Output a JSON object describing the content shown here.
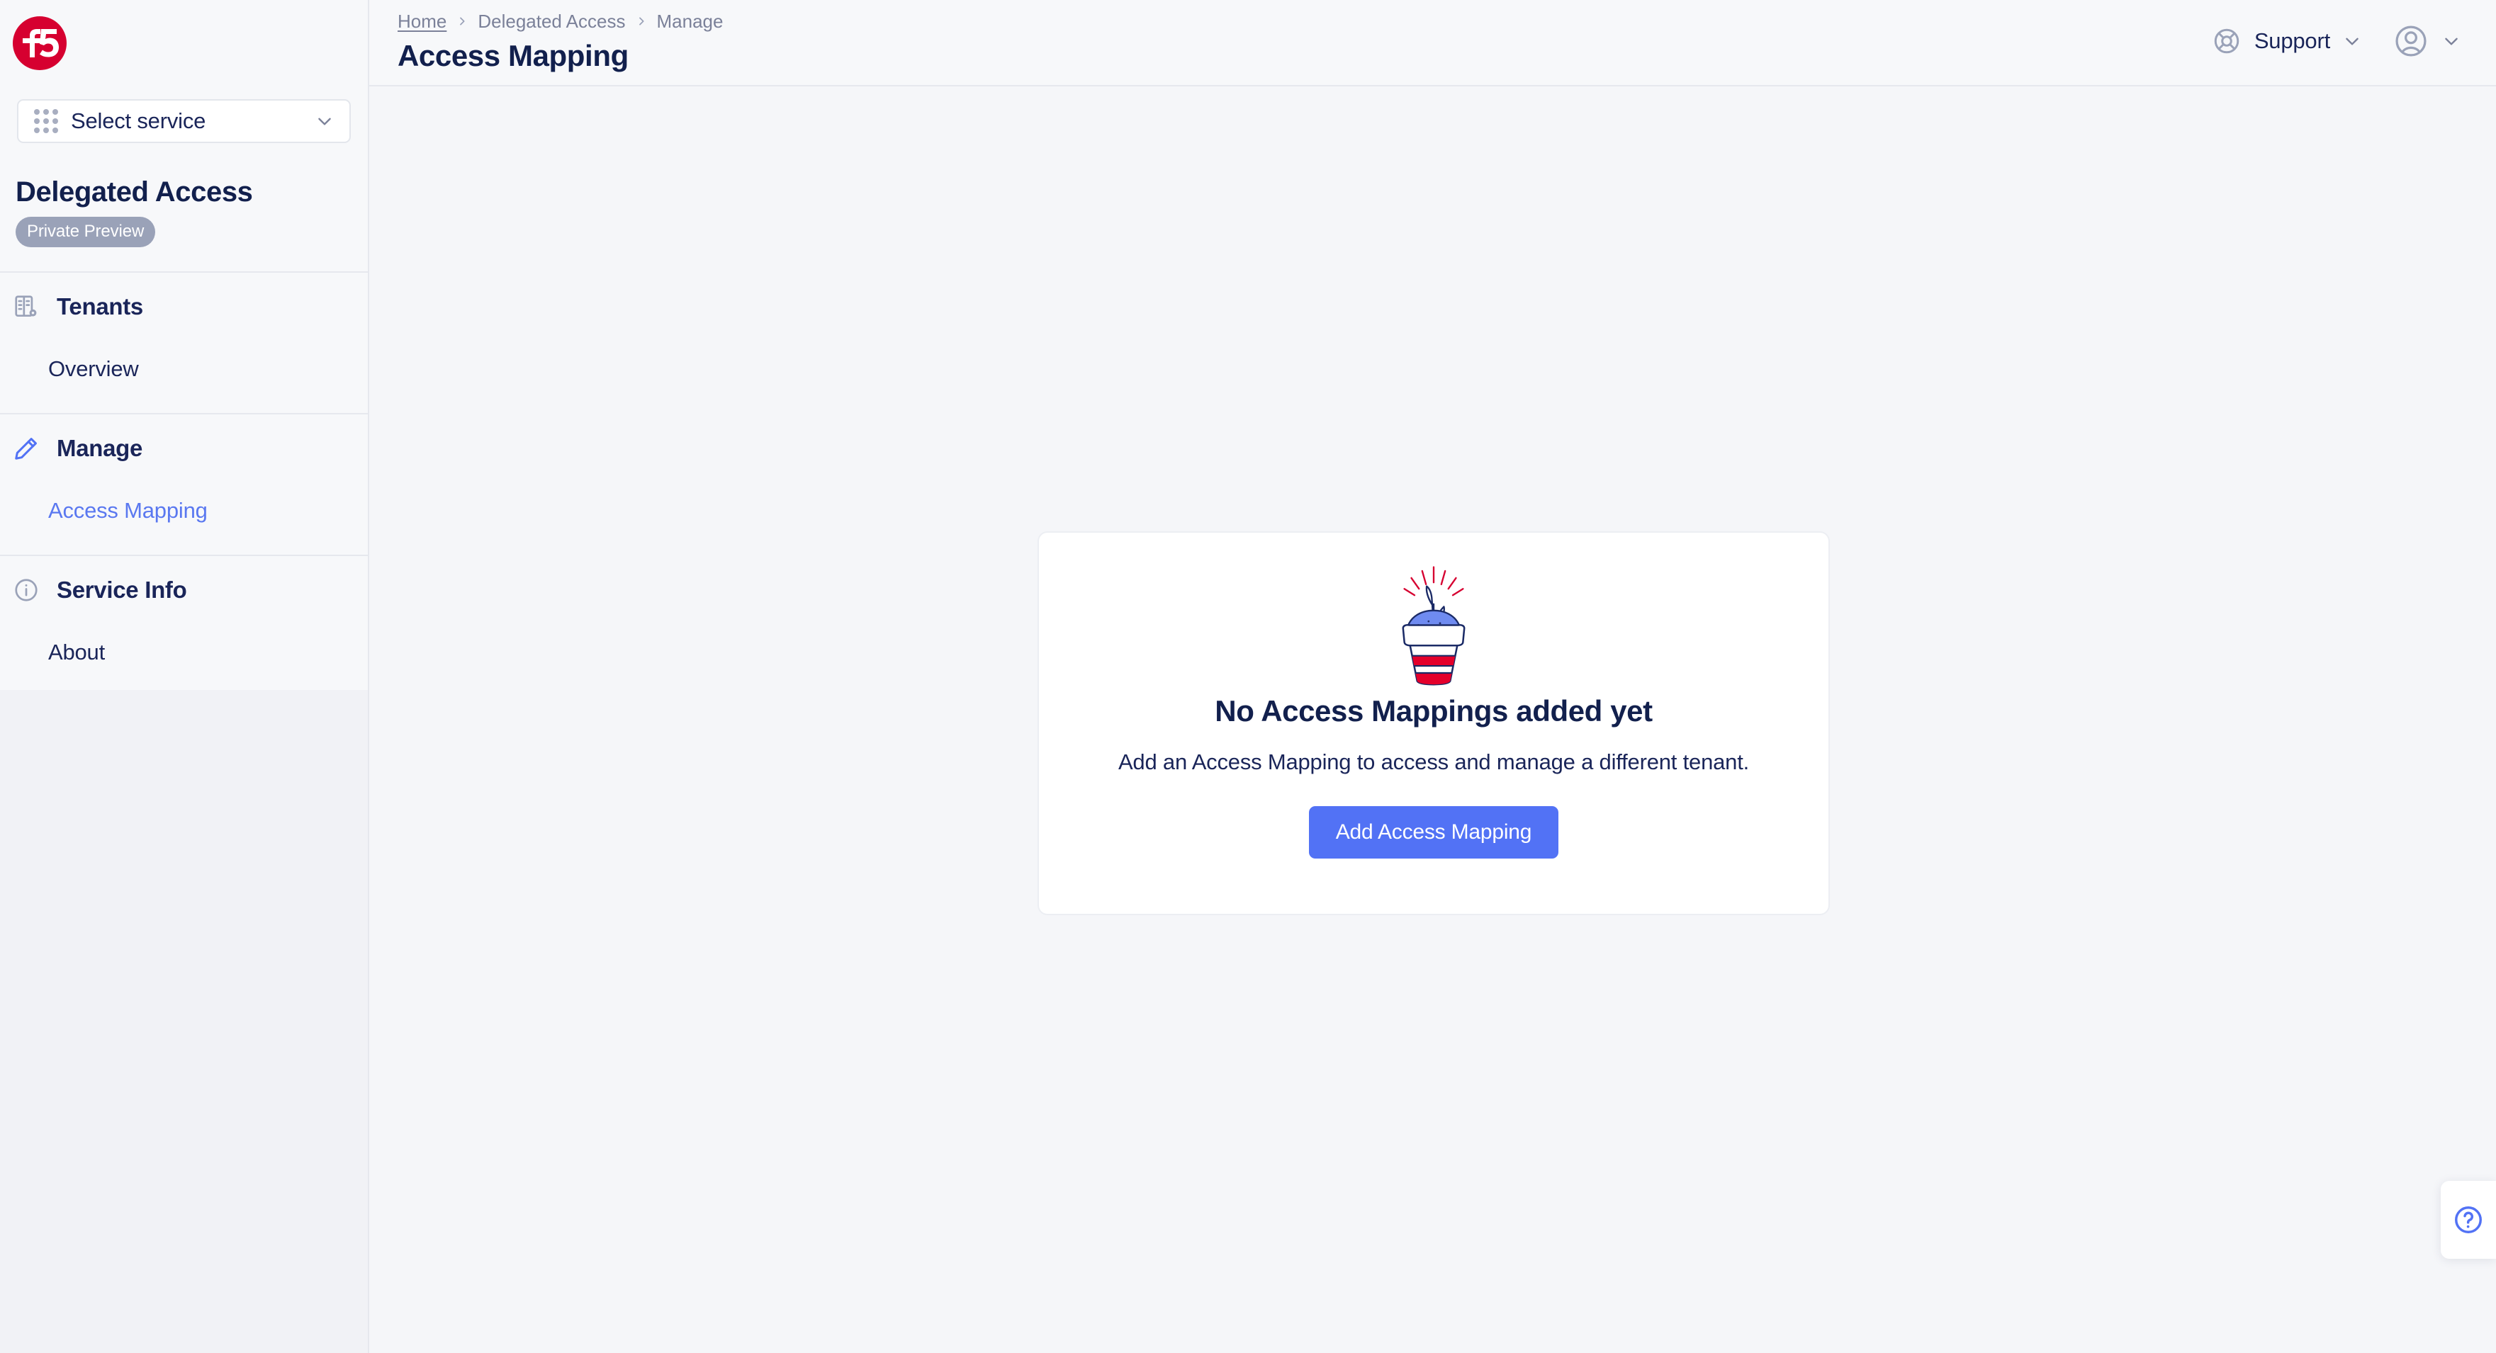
{
  "brand": {
    "logo_name": "f5-logo",
    "logo_text": "f5",
    "logo_color": "#d60030"
  },
  "sidebar": {
    "service_selector": {
      "label": "Select service",
      "icon": "grid-dots-icon",
      "chevron": "chevron-down-icon"
    },
    "product": {
      "title": "Delegated Access",
      "badge": "Private Preview"
    },
    "groups": [
      {
        "label": "Tenants",
        "icon": "tenants-building-icon",
        "items": [
          {
            "label": "Overview",
            "active": false
          }
        ]
      },
      {
        "label": "Manage",
        "icon": "pencil-icon",
        "items": [
          {
            "label": "Access Mapping",
            "active": true
          }
        ]
      },
      {
        "label": "Service Info",
        "icon": "info-circle-icon",
        "items": [
          {
            "label": "About",
            "active": false
          }
        ]
      }
    ]
  },
  "topbar": {
    "breadcrumb": [
      {
        "label": "Home",
        "is_link": true
      },
      {
        "label": "Delegated Access",
        "is_link": false
      },
      {
        "label": "Manage",
        "is_link": false
      }
    ],
    "page_title": "Access Mapping",
    "support": {
      "label": "Support",
      "icon": "lifebuoy-icon",
      "chevron": "chevron-down-icon"
    },
    "account": {
      "icon": "user-avatar-icon",
      "chevron": "chevron-down-icon"
    }
  },
  "main": {
    "empty_state": {
      "illustration": "flower-pot-seedling-illustration",
      "title": "No Access Mappings added yet",
      "description": "Add an Access Mapping to access and manage a different tenant.",
      "button_label": "Add Access Mapping"
    }
  },
  "help_dock": {
    "icon": "question-mark-circle-icon"
  },
  "colors": {
    "accent_blue": "#5272f5",
    "brand_red": "#d60030",
    "text_navy": "#12204d",
    "muted_gray": "#7b8199",
    "badge_gray": "#9aa2b8",
    "page_bg": "#f5f6f9",
    "card_bg": "#ffffff"
  }
}
